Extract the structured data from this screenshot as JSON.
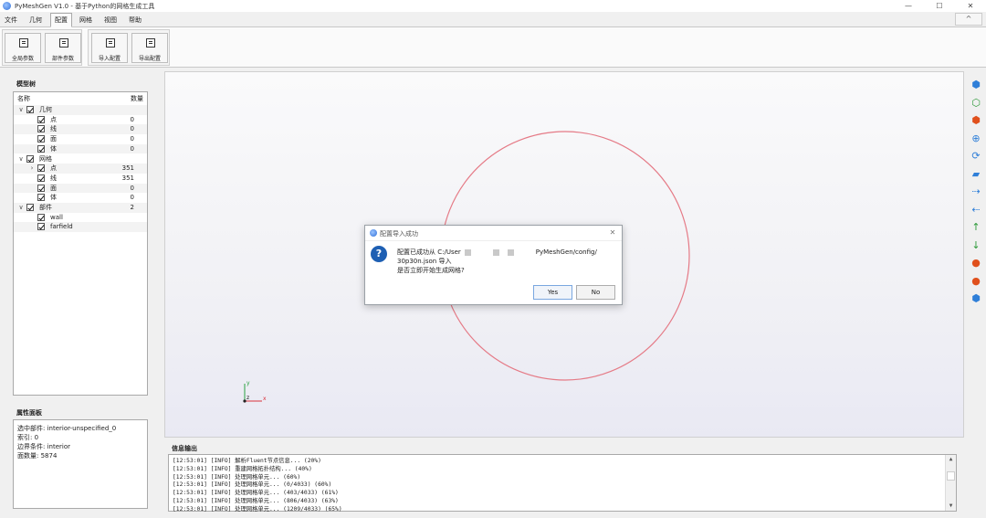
{
  "window": {
    "title": "PyMeshGen V1.0 - 基于Python的网格生成工具",
    "minimize": "—",
    "maximize": "☐",
    "close": "✕"
  },
  "menu": {
    "tabs": [
      "文件",
      "几何",
      "配置",
      "网格",
      "视图",
      "帮助"
    ],
    "active": "配置",
    "collapse": "^"
  },
  "ribbon": {
    "buttons": [
      "全局参数",
      "部件参数",
      "导入配置",
      "导出配置"
    ]
  },
  "model_tree": {
    "title": "模型树",
    "col_name": "名称",
    "col_count": "数量",
    "rows": [
      {
        "name": "几何",
        "count": "",
        "level": 0,
        "expand": "∨"
      },
      {
        "name": "点",
        "count": "0",
        "level": 1,
        "expand": ""
      },
      {
        "name": "线",
        "count": "0",
        "level": 1,
        "expand": ""
      },
      {
        "name": "面",
        "count": "0",
        "level": 1,
        "expand": ""
      },
      {
        "name": "体",
        "count": "0",
        "level": 1,
        "expand": ""
      },
      {
        "name": "网格",
        "count": "",
        "level": 0,
        "expand": "∨"
      },
      {
        "name": "点",
        "count": "351",
        "level": 1,
        "expand": "›"
      },
      {
        "name": "线",
        "count": "351",
        "level": 1,
        "expand": ""
      },
      {
        "name": "面",
        "count": "0",
        "level": 1,
        "expand": ""
      },
      {
        "name": "体",
        "count": "0",
        "level": 1,
        "expand": ""
      },
      {
        "name": "部件",
        "count": "2",
        "level": 0,
        "expand": "∨"
      },
      {
        "name": "wall",
        "count": "",
        "level": 1,
        "expand": ""
      },
      {
        "name": "farfield",
        "count": "",
        "level": 1,
        "expand": ""
      }
    ]
  },
  "properties": {
    "title": "属性面板",
    "lines": [
      "选中部件: interior-unspecified_0",
      "索引: 0",
      "边界条件: interior",
      "面数量: 5874"
    ]
  },
  "axes": {
    "x": "x",
    "y": "y",
    "z": "z"
  },
  "dialog": {
    "title": "配置导入成功",
    "close": "✕",
    "icon": "?",
    "line1_a": "配置已成功从 C:/User",
    "line1_b": "PyMeshGen/config/",
    "line2": "30p30n.json 导入",
    "line3": "是否立即开始生成网格?",
    "yes": "Yes",
    "no": "No"
  },
  "info_output": {
    "title": "信息输出",
    "lines": [
      "[12:53:01] [INFO] 解析Fluent节点信息... (20%)",
      "[12:53:01] [INFO] 重建网格拓扑结构... (40%)",
      "[12:53:01] [INFO] 处理网格单元... (60%)",
      "[12:53:01] [INFO] 处理网格单元... (0/4033) (60%)",
      "[12:53:01] [INFO] 处理网格单元... (403/4033) (61%)",
      "[12:53:01] [INFO] 处理网格单元... (806/4033) (63%)",
      "[12:53:01] [INFO] 处理网格单元... (1209/4033) (65%)"
    ]
  },
  "right_toolbar": [
    {
      "icon": "cube-blue-icon",
      "color": "#2f7fd8"
    },
    {
      "icon": "cube-green-icon",
      "color": "#2e9a3a"
    },
    {
      "icon": "cube-orange-icon",
      "color": "#e0501c"
    },
    {
      "icon": "zoom-fit-icon",
      "color": "#2f7fd8"
    },
    {
      "icon": "rotate-icon",
      "color": "#2f7fd8"
    },
    {
      "icon": "layers-icon",
      "color": "#2f7fd8"
    },
    {
      "icon": "view-x-plus-icon",
      "color": "#2f7fd8"
    },
    {
      "icon": "view-x-minus-icon",
      "color": "#2f7fd8"
    },
    {
      "icon": "view-y-plus-icon",
      "color": "#2e9a3a"
    },
    {
      "icon": "view-y-minus-icon",
      "color": "#2e9a3a"
    },
    {
      "icon": "view-z-plus-icon",
      "color": "#e0501c"
    },
    {
      "icon": "view-z-minus-icon",
      "color": "#e0501c"
    },
    {
      "icon": "iso-view-icon",
      "color": "#2f7fd8"
    }
  ],
  "colors": {
    "circle": "#e57a86",
    "axis_x": "#d9323a",
    "axis_y": "#28a040",
    "axis_z": "#222222"
  }
}
